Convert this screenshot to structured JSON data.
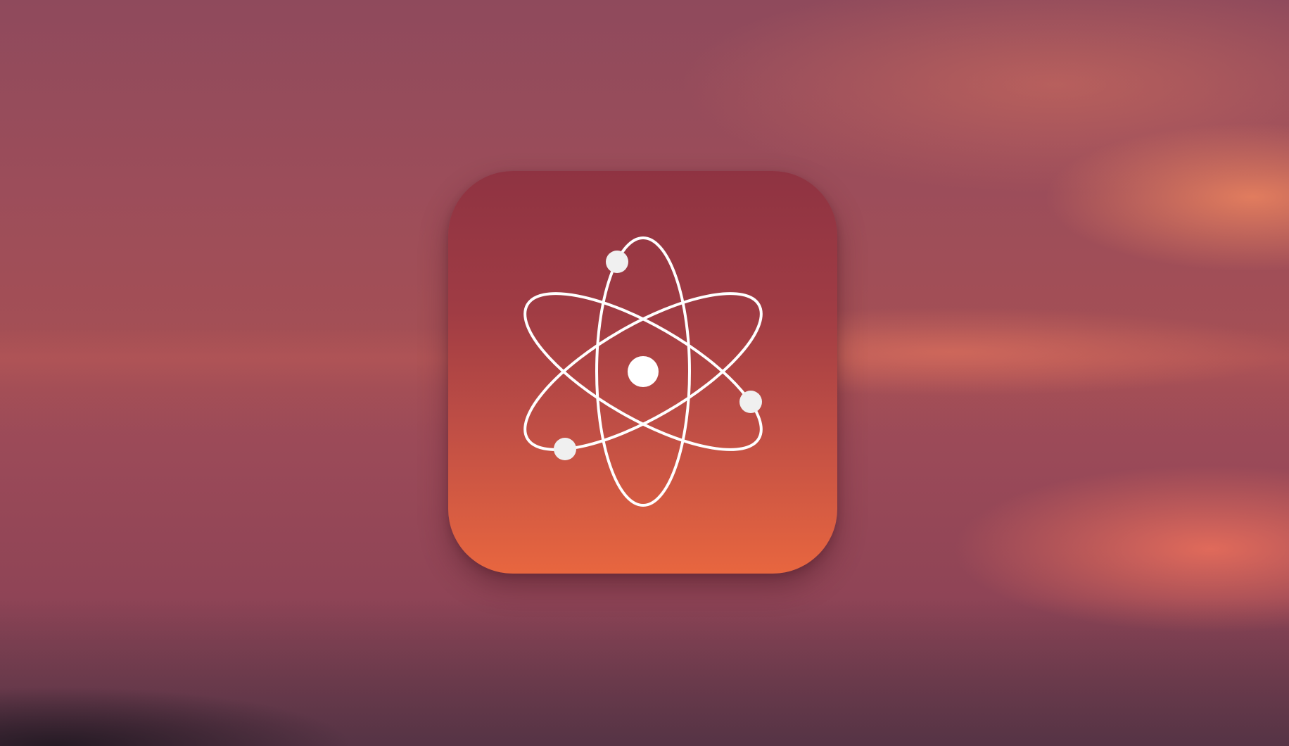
{
  "icon": {
    "name": "atom-icon",
    "colors": {
      "gradient_top": "#8f3342",
      "gradient_bottom": "#e8663f",
      "symbol": "#ffffff",
      "electron": "#f0f0f0"
    }
  },
  "background": {
    "colors": [
      "#8f4a5c",
      "#a44f55",
      "#f88c5f",
      "#fa765c"
    ]
  }
}
